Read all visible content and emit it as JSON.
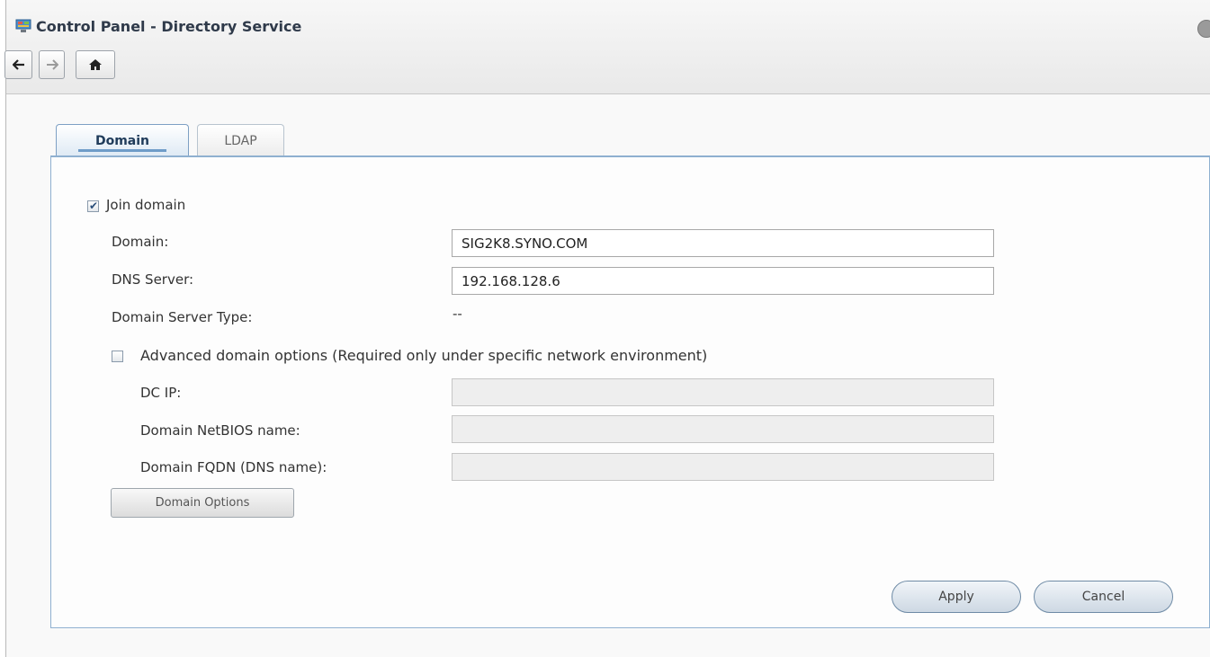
{
  "window": {
    "title": "Control Panel - Directory Service",
    "app_icon": "control-panel-icon"
  },
  "nav": {
    "back_icon": "arrow-left-icon",
    "forward_icon": "arrow-right-icon",
    "home_icon": "home-icon"
  },
  "tabs": [
    {
      "label": "Domain",
      "active": true
    },
    {
      "label": "LDAP",
      "active": false
    }
  ],
  "form": {
    "join_domain": {
      "label": "Join domain",
      "checked": true
    },
    "domain": {
      "label": "Domain:",
      "value": "SIG2K8.SYNO.COM"
    },
    "dns_server": {
      "label": "DNS Server:",
      "value": "192.168.128.6"
    },
    "domain_server_type": {
      "label": "Domain Server Type:",
      "value": "--"
    },
    "advanced": {
      "label": "Advanced domain options (Required only under specific network environment)",
      "checked": false
    },
    "dc_ip": {
      "label": "DC IP:",
      "value": ""
    },
    "netbios_name": {
      "label": "Domain NetBIOS name:",
      "value": ""
    },
    "fqdn": {
      "label": "Domain FQDN (DNS name):",
      "value": ""
    },
    "domain_options_button": "Domain Options"
  },
  "footer": {
    "apply": "Apply",
    "cancel": "Cancel"
  },
  "colors": {
    "tab_accent": "#6f9cc8",
    "panel_border": "#8fb0d0"
  }
}
